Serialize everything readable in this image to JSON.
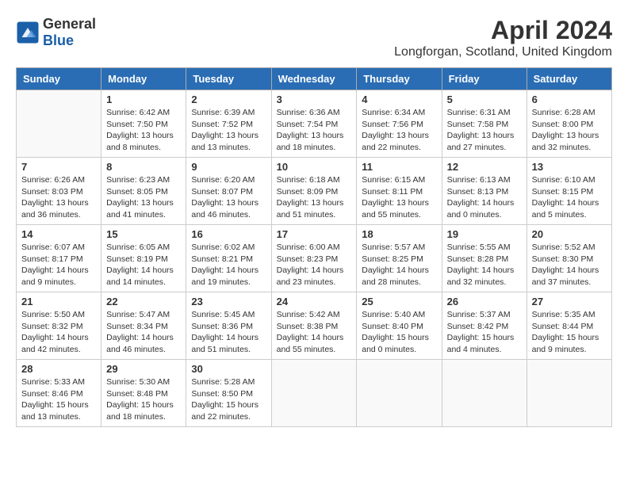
{
  "header": {
    "logo_general": "General",
    "logo_blue": "Blue",
    "month_year": "April 2024",
    "location": "Longforgan, Scotland, United Kingdom"
  },
  "days_of_week": [
    "Sunday",
    "Monday",
    "Tuesday",
    "Wednesday",
    "Thursday",
    "Friday",
    "Saturday"
  ],
  "weeks": [
    [
      {
        "day": "",
        "info": ""
      },
      {
        "day": "1",
        "info": "Sunrise: 6:42 AM\nSunset: 7:50 PM\nDaylight: 13 hours\nand 8 minutes."
      },
      {
        "day": "2",
        "info": "Sunrise: 6:39 AM\nSunset: 7:52 PM\nDaylight: 13 hours\nand 13 minutes."
      },
      {
        "day": "3",
        "info": "Sunrise: 6:36 AM\nSunset: 7:54 PM\nDaylight: 13 hours\nand 18 minutes."
      },
      {
        "day": "4",
        "info": "Sunrise: 6:34 AM\nSunset: 7:56 PM\nDaylight: 13 hours\nand 22 minutes."
      },
      {
        "day": "5",
        "info": "Sunrise: 6:31 AM\nSunset: 7:58 PM\nDaylight: 13 hours\nand 27 minutes."
      },
      {
        "day": "6",
        "info": "Sunrise: 6:28 AM\nSunset: 8:00 PM\nDaylight: 13 hours\nand 32 minutes."
      }
    ],
    [
      {
        "day": "7",
        "info": "Sunrise: 6:26 AM\nSunset: 8:03 PM\nDaylight: 13 hours\nand 36 minutes."
      },
      {
        "day": "8",
        "info": "Sunrise: 6:23 AM\nSunset: 8:05 PM\nDaylight: 13 hours\nand 41 minutes."
      },
      {
        "day": "9",
        "info": "Sunrise: 6:20 AM\nSunset: 8:07 PM\nDaylight: 13 hours\nand 46 minutes."
      },
      {
        "day": "10",
        "info": "Sunrise: 6:18 AM\nSunset: 8:09 PM\nDaylight: 13 hours\nand 51 minutes."
      },
      {
        "day": "11",
        "info": "Sunrise: 6:15 AM\nSunset: 8:11 PM\nDaylight: 13 hours\nand 55 minutes."
      },
      {
        "day": "12",
        "info": "Sunrise: 6:13 AM\nSunset: 8:13 PM\nDaylight: 14 hours\nand 0 minutes."
      },
      {
        "day": "13",
        "info": "Sunrise: 6:10 AM\nSunset: 8:15 PM\nDaylight: 14 hours\nand 5 minutes."
      }
    ],
    [
      {
        "day": "14",
        "info": "Sunrise: 6:07 AM\nSunset: 8:17 PM\nDaylight: 14 hours\nand 9 minutes."
      },
      {
        "day": "15",
        "info": "Sunrise: 6:05 AM\nSunset: 8:19 PM\nDaylight: 14 hours\nand 14 minutes."
      },
      {
        "day": "16",
        "info": "Sunrise: 6:02 AM\nSunset: 8:21 PM\nDaylight: 14 hours\nand 19 minutes."
      },
      {
        "day": "17",
        "info": "Sunrise: 6:00 AM\nSunset: 8:23 PM\nDaylight: 14 hours\nand 23 minutes."
      },
      {
        "day": "18",
        "info": "Sunrise: 5:57 AM\nSunset: 8:25 PM\nDaylight: 14 hours\nand 28 minutes."
      },
      {
        "day": "19",
        "info": "Sunrise: 5:55 AM\nSunset: 8:28 PM\nDaylight: 14 hours\nand 32 minutes."
      },
      {
        "day": "20",
        "info": "Sunrise: 5:52 AM\nSunset: 8:30 PM\nDaylight: 14 hours\nand 37 minutes."
      }
    ],
    [
      {
        "day": "21",
        "info": "Sunrise: 5:50 AM\nSunset: 8:32 PM\nDaylight: 14 hours\nand 42 minutes."
      },
      {
        "day": "22",
        "info": "Sunrise: 5:47 AM\nSunset: 8:34 PM\nDaylight: 14 hours\nand 46 minutes."
      },
      {
        "day": "23",
        "info": "Sunrise: 5:45 AM\nSunset: 8:36 PM\nDaylight: 14 hours\nand 51 minutes."
      },
      {
        "day": "24",
        "info": "Sunrise: 5:42 AM\nSunset: 8:38 PM\nDaylight: 14 hours\nand 55 minutes."
      },
      {
        "day": "25",
        "info": "Sunrise: 5:40 AM\nSunset: 8:40 PM\nDaylight: 15 hours\nand 0 minutes."
      },
      {
        "day": "26",
        "info": "Sunrise: 5:37 AM\nSunset: 8:42 PM\nDaylight: 15 hours\nand 4 minutes."
      },
      {
        "day": "27",
        "info": "Sunrise: 5:35 AM\nSunset: 8:44 PM\nDaylight: 15 hours\nand 9 minutes."
      }
    ],
    [
      {
        "day": "28",
        "info": "Sunrise: 5:33 AM\nSunset: 8:46 PM\nDaylight: 15 hours\nand 13 minutes."
      },
      {
        "day": "29",
        "info": "Sunrise: 5:30 AM\nSunset: 8:48 PM\nDaylight: 15 hours\nand 18 minutes."
      },
      {
        "day": "30",
        "info": "Sunrise: 5:28 AM\nSunset: 8:50 PM\nDaylight: 15 hours\nand 22 minutes."
      },
      {
        "day": "",
        "info": ""
      },
      {
        "day": "",
        "info": ""
      },
      {
        "day": "",
        "info": ""
      },
      {
        "day": "",
        "info": ""
      }
    ]
  ]
}
